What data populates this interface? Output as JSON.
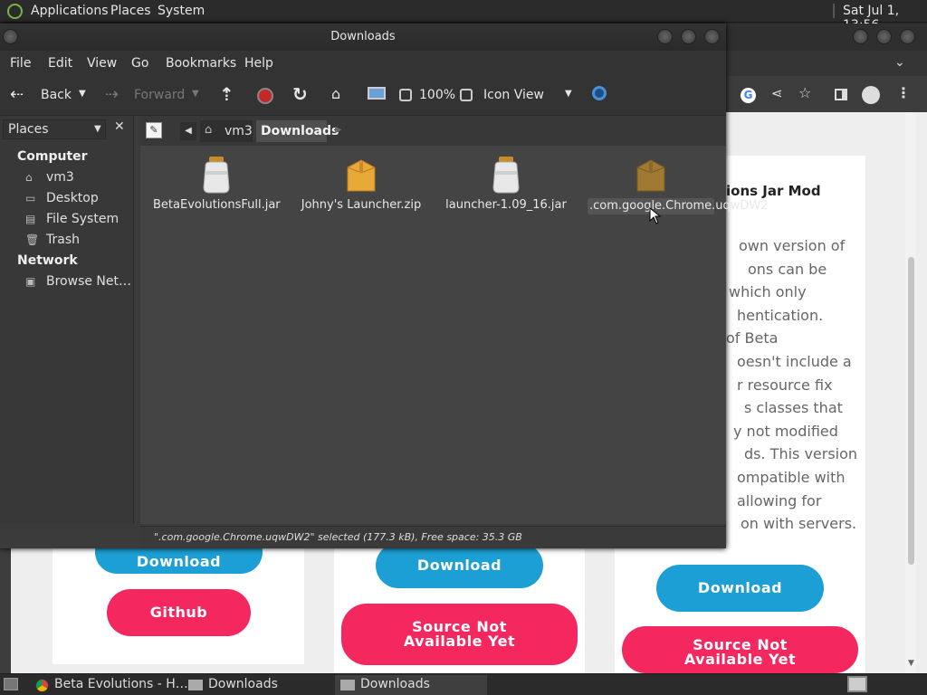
{
  "top_panel": {
    "menus": [
      "Applications",
      "Places",
      "System"
    ],
    "clock": "Sat Jul 1, 13:56"
  },
  "file_manager": {
    "title": "Downloads",
    "menu": [
      "File",
      "Edit",
      "View",
      "Go",
      "Bookmarks",
      "Help"
    ],
    "toolbar": {
      "back": "Back",
      "forward": "Forward",
      "zoom": "100%",
      "view_mode": "Icon View"
    },
    "sidebar": {
      "header": "Places",
      "sections": [
        {
          "title": "Computer",
          "items": [
            "vm3",
            "Desktop",
            "File System",
            "Trash"
          ]
        },
        {
          "title": "Network",
          "items": [
            "Browse Net…"
          ]
        }
      ]
    },
    "path": [
      "vm3",
      "Downloads"
    ],
    "files": [
      {
        "name": "BetaEvolutionsFull.jar",
        "icon": "jar-icon"
      },
      {
        "name": "Johny's Launcher.zip",
        "icon": "archive-icon"
      },
      {
        "name": "launcher-1.09_16.jar",
        "icon": "jar-icon"
      },
      {
        "name": ".com.google.Chrome.uqwDW2",
        "icon": "archive-icon",
        "selected": true
      }
    ],
    "status": "\".com.google.Chrome.uqwDW2\" selected (177.3 kB), Free space: 35.3 GB"
  },
  "browser": {
    "article_heading": "ions Jar Mod",
    "article_lines": [
      "own version of",
      "ons can be",
      "which only",
      "hentication.",
      "of Beta",
      "oesn't include a",
      "r resource fix",
      "s classes that",
      "y not modified",
      "ds. This version",
      "ompatible with",
      "allowing for",
      "on with servers."
    ],
    "buttons": {
      "download_partial": "Download",
      "github": "Github",
      "download": "Download",
      "source_not_available": "Source Not Available Yet"
    }
  },
  "taskbar": {
    "tasks": [
      "Beta Evolutions - H…",
      "Downloads",
      "Downloads"
    ]
  },
  "colors": {
    "blue_button": "#1c9fd4",
    "pink_button": "#f5275f"
  }
}
